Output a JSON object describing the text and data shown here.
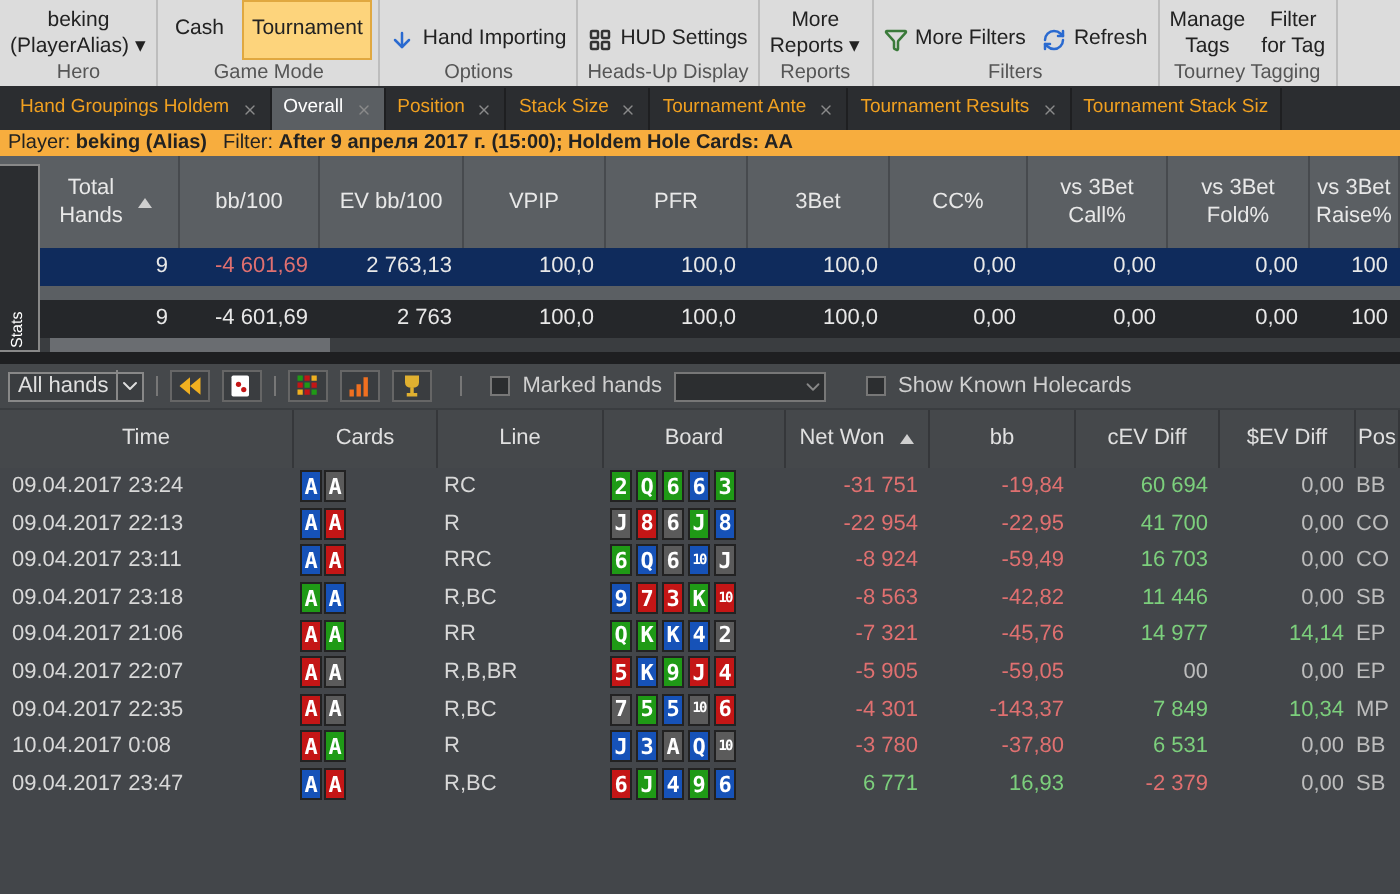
{
  "ribbon": [
    {
      "label": "Hero",
      "items": [
        {
          "kind": "menu",
          "lines": [
            "beking",
            "(PlayerAlias)"
          ],
          "caret": "▾"
        }
      ]
    },
    {
      "label": "Game Mode",
      "items": [
        {
          "kind": "toggle",
          "label": "Cash",
          "selected": false
        },
        {
          "kind": "toggle",
          "label": "Tournament",
          "selected": true
        }
      ]
    },
    {
      "label": "Options",
      "items": [
        {
          "kind": "small",
          "label": "Hand Importing"
        }
      ]
    },
    {
      "label": "Heads-Up Display",
      "items": [
        {
          "kind": "small",
          "label": "HUD Settings"
        }
      ]
    },
    {
      "label": "Reports",
      "items": [
        {
          "kind": "menu",
          "lines": [
            "More",
            "Reports"
          ],
          "caret": "▾"
        }
      ]
    },
    {
      "label": "Filters",
      "items": [
        {
          "kind": "small",
          "label": "More Filters"
        },
        {
          "kind": "small",
          "label": "Refresh"
        }
      ]
    },
    {
      "label": "Tourney Tagging",
      "items": [
        {
          "kind": "large",
          "lines": [
            "Manage",
            "Tags"
          ]
        },
        {
          "kind": "large",
          "lines": [
            "Filter",
            "for Tag"
          ]
        }
      ]
    }
  ],
  "tabs": [
    {
      "label": "Hand Groupings Holdem",
      "selected": false,
      "closable": true
    },
    {
      "label": "Overall",
      "selected": true,
      "closable": true
    },
    {
      "label": "Position",
      "selected": false,
      "closable": true
    },
    {
      "label": "Stack Size",
      "selected": false,
      "closable": true
    },
    {
      "label": "Tournament Ante",
      "selected": false,
      "closable": true
    },
    {
      "label": "Tournament Results",
      "selected": false,
      "closable": true
    },
    {
      "label": "Tournament Stack Siz",
      "selected": false,
      "closable": false
    }
  ],
  "filter_bar": {
    "player": "Player: **beking (Alias)**",
    "filter": "Filter: **After 9 апреля 2017 г. (15:00); Holdem Hole Cards: AA**"
  },
  "stats": {
    "side_tab": "Stats",
    "columns": [
      {
        "lines": [
          "Total",
          "Hands"
        ],
        "sorted": true
      },
      {
        "lines": [
          "bb/100"
        ],
        "sorted": false
      },
      {
        "lines": [
          "EV bb/100"
        ],
        "sorted": false
      },
      {
        "lines": [
          "VPIP"
        ],
        "sorted": false
      },
      {
        "lines": [
          "PFR"
        ],
        "sorted": false
      },
      {
        "lines": [
          "3Bet"
        ],
        "sorted": false
      },
      {
        "lines": [
          "CC%"
        ],
        "sorted": false
      },
      {
        "lines": [
          "vs 3Bet",
          "Call%"
        ],
        "sorted": false
      },
      {
        "lines": [
          "vs 3Bet",
          "Fold%"
        ],
        "sorted": false
      },
      {
        "lines": [
          "vs 3Bet",
          "Raise%"
        ],
        "sorted": false
      }
    ],
    "rows": [
      {
        "selected": true,
        "cells": [
          {
            "text": "9",
            "color": "#e8e8e8"
          },
          {
            "text": "-4 601,69",
            "color": "#e07070"
          },
          {
            "text": "2 763,13",
            "color": "#e8e8e8"
          },
          {
            "text": "100,0",
            "color": "#e8e8e8"
          },
          {
            "text": "100,0",
            "color": "#e8e8e8"
          },
          {
            "text": "100,0",
            "color": "#e8e8e8"
          },
          {
            "text": "0,00",
            "color": "#e8e8e8"
          },
          {
            "text": "0,00",
            "color": "#e8e8e8"
          },
          {
            "text": "0,00",
            "color": "#e8e8e8"
          },
          {
            "text": "100",
            "color": "#e8e8e8"
          }
        ]
      },
      {
        "selected": false,
        "cells": [
          {
            "text": "9",
            "color": "#e8e8e8"
          },
          {
            "text": "-4 601,69",
            "color": "#e8e8e8"
          },
          {
            "text": "2 763",
            "color": "#e8e8e8"
          },
          {
            "text": "100,0",
            "color": "#e8e8e8"
          },
          {
            "text": "100,0",
            "color": "#e8e8e8"
          },
          {
            "text": "100,0",
            "color": "#e8e8e8"
          },
          {
            "text": "0,00",
            "color": "#e8e8e8"
          },
          {
            "text": "0,00",
            "color": "#e8e8e8"
          },
          {
            "text": "0,00",
            "color": "#e8e8e8"
          },
          {
            "text": "100",
            "color": "#e8e8e8"
          }
        ]
      }
    ]
  },
  "toolbar": {
    "hand_filter": "All hands",
    "marked_hands": {
      "label": "Marked hands",
      "checked": false
    },
    "known_holecards": {
      "label": "Show Known Holecards",
      "checked": false
    }
  },
  "hands": {
    "columns": [
      {
        "label": "Time",
        "sorted": false
      },
      {
        "label": "Cards",
        "sorted": false
      },
      {
        "label": "Line",
        "sorted": false
      },
      {
        "label": "Board",
        "sorted": false
      },
      {
        "label": "Net Won",
        "sorted": true
      },
      {
        "label": "bb",
        "sorted": false
      },
      {
        "label": "cEV Diff",
        "sorted": false
      },
      {
        "label": "$EV Diff",
        "sorted": false
      },
      {
        "label": "Pos",
        "sorted": false
      }
    ],
    "rows": [
      {
        "time": "09.04.2017 23:24",
        "cards": [
          {
            "rank": "A",
            "color": "#1652b8"
          },
          {
            "rank": "A",
            "color": "#5b5b5b"
          }
        ],
        "line": "RC",
        "board": [
          {
            "rank": "2",
            "color": "#1f9a16"
          },
          {
            "rank": "Q",
            "color": "#1f9a16"
          },
          {
            "rank": "6",
            "color": "#1f9a16"
          },
          {
            "rank": "6",
            "color": "#1652b8"
          },
          {
            "rank": "3",
            "color": "#1f9a16"
          }
        ],
        "net_won": {
          "text": "-31 751",
          "color": "#e07070"
        },
        "bb": {
          "text": "-19,84",
          "color": "#e07070"
        },
        "cev_diff": {
          "text": "60 694",
          "color": "#7ccf7c"
        },
        "sev_diff": {
          "text": "0,00",
          "color": "#bdbdbd"
        },
        "pos": "BB"
      },
      {
        "time": "09.04.2017 22:13",
        "cards": [
          {
            "rank": "A",
            "color": "#1652b8"
          },
          {
            "rank": "A",
            "color": "#c41616"
          }
        ],
        "line": "R",
        "board": [
          {
            "rank": "J",
            "color": "#5b5b5b"
          },
          {
            "rank": "8",
            "color": "#c41616"
          },
          {
            "rank": "6",
            "color": "#5b5b5b"
          },
          {
            "rank": "J",
            "color": "#1f9a16"
          },
          {
            "rank": "8",
            "color": "#1652b8"
          }
        ],
        "net_won": {
          "text": "-22 954",
          "color": "#e07070"
        },
        "bb": {
          "text": "-22,95",
          "color": "#e07070"
        },
        "cev_diff": {
          "text": "41 700",
          "color": "#7ccf7c"
        },
        "sev_diff": {
          "text": "0,00",
          "color": "#bdbdbd"
        },
        "pos": "CO"
      },
      {
        "time": "09.04.2017 23:11",
        "cards": [
          {
            "rank": "A",
            "color": "#1652b8"
          },
          {
            "rank": "A",
            "color": "#c41616"
          }
        ],
        "line": "RRC",
        "board": [
          {
            "rank": "6",
            "color": "#1f9a16"
          },
          {
            "rank": "Q",
            "color": "#1652b8"
          },
          {
            "rank": "6",
            "color": "#5b5b5b"
          },
          {
            "rank": "10",
            "color": "#1652b8"
          },
          {
            "rank": "J",
            "color": "#5b5b5b"
          }
        ],
        "net_won": {
          "text": "-8 924",
          "color": "#e07070"
        },
        "bb": {
          "text": "-59,49",
          "color": "#e07070"
        },
        "cev_diff": {
          "text": "16 703",
          "color": "#7ccf7c"
        },
        "sev_diff": {
          "text": "0,00",
          "color": "#bdbdbd"
        },
        "pos": "CO"
      },
      {
        "time": "09.04.2017 23:18",
        "cards": [
          {
            "rank": "A",
            "color": "#1f9a16"
          },
          {
            "rank": "A",
            "color": "#1652b8"
          }
        ],
        "line": "R,BC",
        "board": [
          {
            "rank": "9",
            "color": "#1652b8"
          },
          {
            "rank": "7",
            "color": "#c41616"
          },
          {
            "rank": "3",
            "color": "#c41616"
          },
          {
            "rank": "K",
            "color": "#1f9a16"
          },
          {
            "rank": "10",
            "color": "#c41616"
          }
        ],
        "net_won": {
          "text": "-8 563",
          "color": "#e07070"
        },
        "bb": {
          "text": "-42,82",
          "color": "#e07070"
        },
        "cev_diff": {
          "text": "11 446",
          "color": "#7ccf7c"
        },
        "sev_diff": {
          "text": "0,00",
          "color": "#bdbdbd"
        },
        "pos": "SB"
      },
      {
        "time": "09.04.2017 21:06",
        "cards": [
          {
            "rank": "A",
            "color": "#c41616"
          },
          {
            "rank": "A",
            "color": "#1f9a16"
          }
        ],
        "line": "RR",
        "board": [
          {
            "rank": "Q",
            "color": "#1f9a16"
          },
          {
            "rank": "K",
            "color": "#1f9a16"
          },
          {
            "rank": "K",
            "color": "#1652b8"
          },
          {
            "rank": "4",
            "color": "#1652b8"
          },
          {
            "rank": "2",
            "color": "#5b5b5b"
          }
        ],
        "net_won": {
          "text": "-7 321",
          "color": "#e07070"
        },
        "bb": {
          "text": "-45,76",
          "color": "#e07070"
        },
        "cev_diff": {
          "text": "14 977",
          "color": "#7ccf7c"
        },
        "sev_diff": {
          "text": "14,14",
          "color": "#7ccf7c"
        },
        "pos": "EP"
      },
      {
        "time": "09.04.2017 22:07",
        "cards": [
          {
            "rank": "A",
            "color": "#c41616"
          },
          {
            "rank": "A",
            "color": "#5b5b5b"
          }
        ],
        "line": "R,B,BR",
        "board": [
          {
            "rank": "5",
            "color": "#c41616"
          },
          {
            "rank": "K",
            "color": "#1652b8"
          },
          {
            "rank": "9",
            "color": "#1f9a16"
          },
          {
            "rank": "J",
            "color": "#c41616"
          },
          {
            "rank": "4",
            "color": "#c41616"
          }
        ],
        "net_won": {
          "text": "-5 905",
          "color": "#e07070"
        },
        "bb": {
          "text": "-59,05",
          "color": "#e07070"
        },
        "cev_diff": {
          "text": "00",
          "color": "#bdbdbd"
        },
        "sev_diff": {
          "text": "0,00",
          "color": "#bdbdbd"
        },
        "pos": "EP"
      },
      {
        "time": "09.04.2017 22:35",
        "cards": [
          {
            "rank": "A",
            "color": "#c41616"
          },
          {
            "rank": "A",
            "color": "#5b5b5b"
          }
        ],
        "line": "R,BC",
        "board": [
          {
            "rank": "7",
            "color": "#5b5b5b"
          },
          {
            "rank": "5",
            "color": "#1f9a16"
          },
          {
            "rank": "5",
            "color": "#1652b8"
          },
          {
            "rank": "10",
            "color": "#5b5b5b"
          },
          {
            "rank": "6",
            "color": "#c41616"
          }
        ],
        "net_won": {
          "text": "-4 301",
          "color": "#e07070"
        },
        "bb": {
          "text": "-143,37",
          "color": "#e07070"
        },
        "cev_diff": {
          "text": "7 849",
          "color": "#7ccf7c"
        },
        "sev_diff": {
          "text": "10,34",
          "color": "#7ccf7c"
        },
        "pos": "MP"
      },
      {
        "time": "10.04.2017 0:08",
        "cards": [
          {
            "rank": "A",
            "color": "#c41616"
          },
          {
            "rank": "A",
            "color": "#1f9a16"
          }
        ],
        "line": "R",
        "board": [
          {
            "rank": "J",
            "color": "#1652b8"
          },
          {
            "rank": "3",
            "color": "#1652b8"
          },
          {
            "rank": "A",
            "color": "#5b5b5b"
          },
          {
            "rank": "Q",
            "color": "#1652b8"
          },
          {
            "rank": "10",
            "color": "#5b5b5b"
          }
        ],
        "net_won": {
          "text": "-3 780",
          "color": "#e07070"
        },
        "bb": {
          "text": "-37,80",
          "color": "#e07070"
        },
        "cev_diff": {
          "text": "6 531",
          "color": "#7ccf7c"
        },
        "sev_diff": {
          "text": "0,00",
          "color": "#bdbdbd"
        },
        "pos": "BB"
      },
      {
        "time": "09.04.2017 23:47",
        "cards": [
          {
            "rank": "A",
            "color": "#1652b8"
          },
          {
            "rank": "A",
            "color": "#c41616"
          }
        ],
        "line": "R,BC",
        "board": [
          {
            "rank": "6",
            "color": "#c41616"
          },
          {
            "rank": "J",
            "color": "#1f9a16"
          },
          {
            "rank": "4",
            "color": "#1652b8"
          },
          {
            "rank": "9",
            "color": "#1f9a16"
          },
          {
            "rank": "6",
            "color": "#1652b8"
          }
        ],
        "net_won": {
          "text": "6 771",
          "color": "#7ccf7c"
        },
        "bb": {
          "text": "16,93",
          "color": "#7ccf7c"
        },
        "cev_diff": {
          "text": "-2 379",
          "color": "#e07070"
        },
        "sev_diff": {
          "text": "0,00",
          "color": "#bdbdbd"
        },
        "pos": "SB"
      }
    ]
  }
}
